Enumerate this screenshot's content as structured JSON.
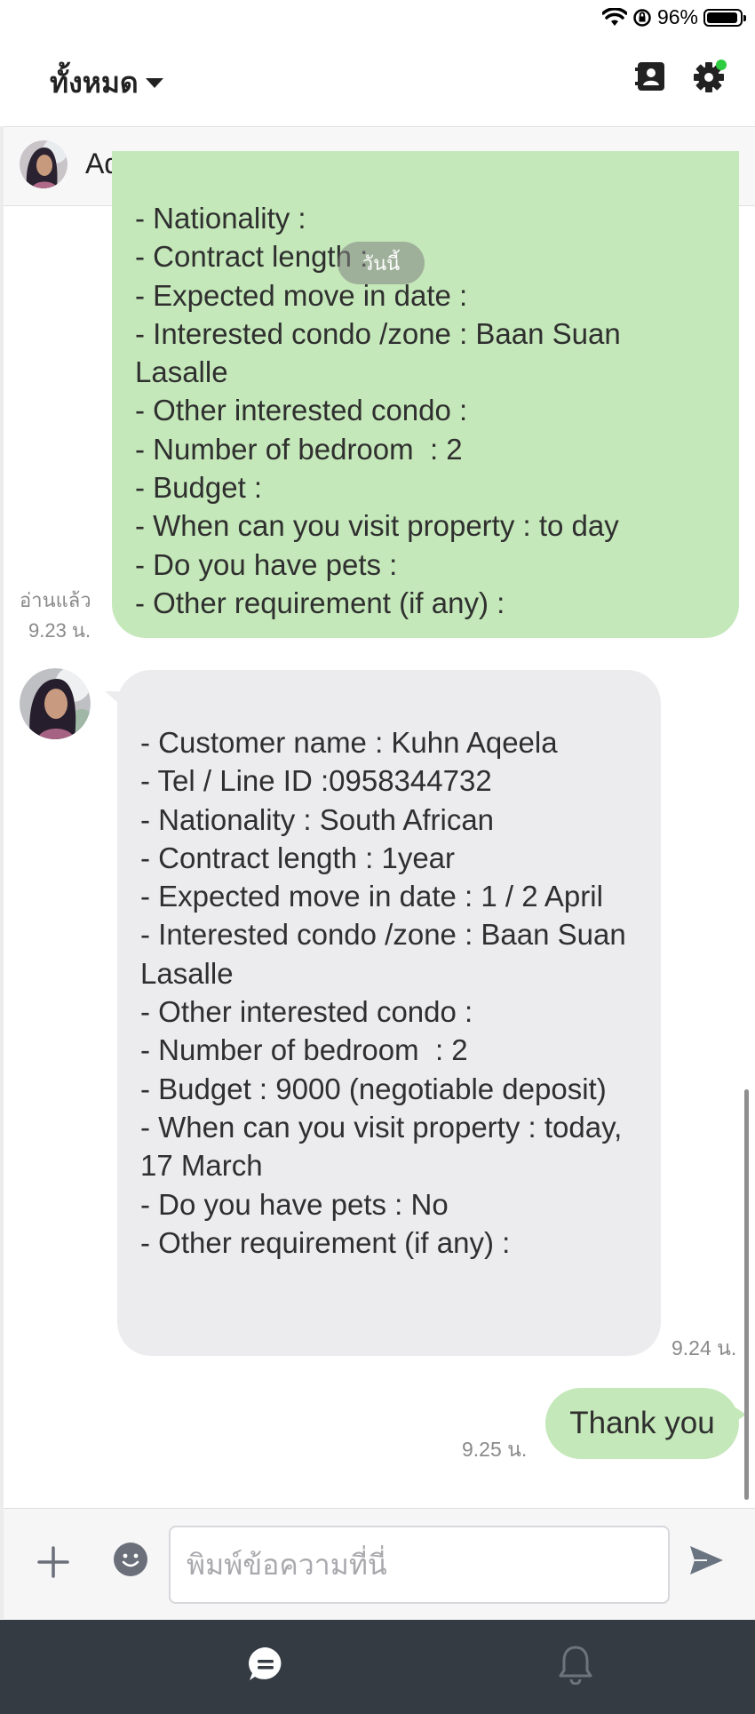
{
  "status_bar": {
    "battery_text": "96%",
    "battery_level": 0.96
  },
  "header": {
    "filter_label": "ทั้งหมด"
  },
  "chat": {
    "contact_name": "Aqeela",
    "date_divider": "วันนี้"
  },
  "messages": [
    {
      "sender": "me",
      "text": "- Nationality :\n- Contract length :\n- Expected move in date :\n- Interested condo /zone : Baan Suan Lasalle\n- Other interested condo :\n- Number of bedroom  : 2\n- Budget :\n- When can you visit property : to day\n- Do you have pets :\n- Other requirement (if any) :",
      "read_status": "อ่านแล้ว",
      "time": "9.23 น."
    },
    {
      "sender": "Aqeela",
      "text": "- Customer name : Kuhn Aqeela\n- Tel / Line ID :0958344732\n- Nationality : South African\n- Contract length : 1year\n- Expected move in date : 1 / 2 April\n- Interested condo /zone : Baan Suan Lasalle\n- Other interested condo :\n- Number of bedroom  : 2\n- Budget : 9000 (negotiable deposit)\n- When can you visit property : today, 17 March\n- Do you have pets : No\n- Other requirement (if any) :",
      "time": "9.24 น."
    },
    {
      "sender": "me",
      "text": "Thank you",
      "time": "9.25 น."
    }
  ],
  "input": {
    "placeholder": "พิมพ์ข้อความที่นี่",
    "value": ""
  },
  "colors": {
    "sent_bubble": "#c4e8b9",
    "received_bubble": "#ececef",
    "nav_bg": "#353b43",
    "status_dot": "#2ecc40"
  },
  "icons": {
    "wifi": "wifi-icon",
    "orientation_lock": "orientation-lock-icon",
    "battery": "battery-icon",
    "contacts": "contact-book-icon",
    "settings": "gear-icon",
    "collapse": "chevron-down-icon",
    "plus": "plus-icon",
    "emoji": "emoji-icon",
    "send": "send-icon",
    "chat_tab": "chat-bubble-icon",
    "notifications": "bell-icon"
  }
}
